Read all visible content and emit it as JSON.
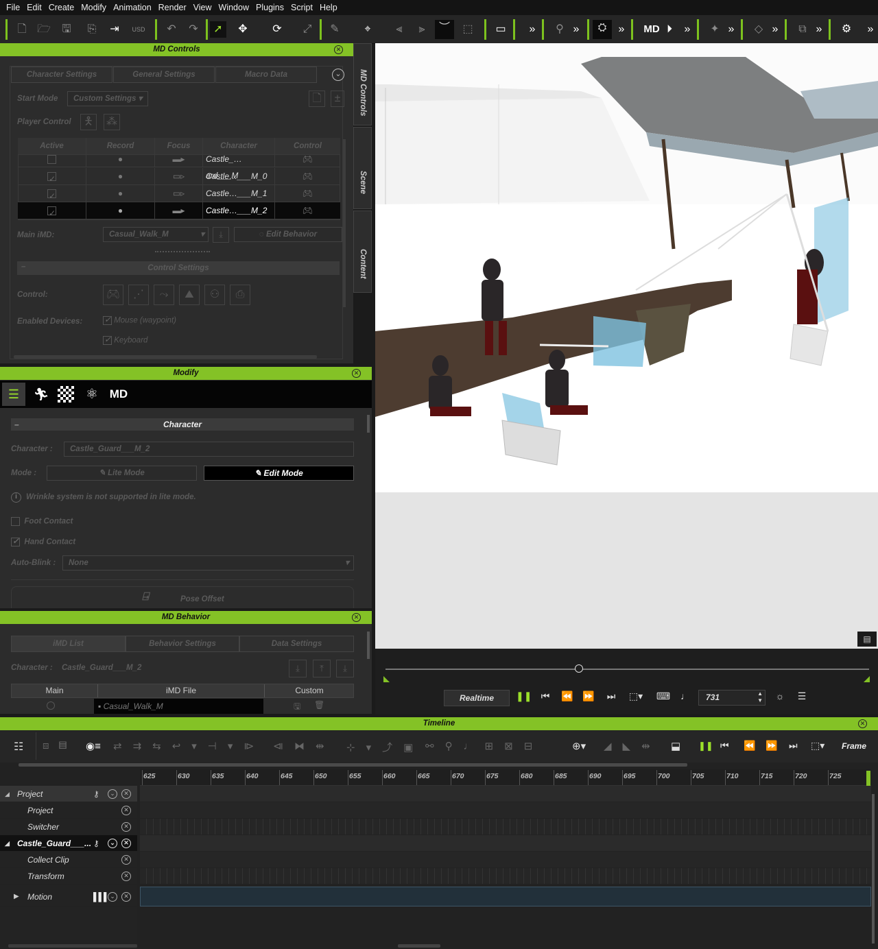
{
  "menu": [
    "File",
    "Edit",
    "Create",
    "Modify",
    "Animation",
    "Render",
    "View",
    "Window",
    "Plugins",
    "Script",
    "Help"
  ],
  "toolbar": {
    "icons": [
      "new-file",
      "open-file",
      "save",
      "export",
      "import",
      "usd",
      "undo",
      "redo",
      "select",
      "move",
      "rotate",
      "scale",
      "paint",
      "ik",
      "align-left",
      "align-right",
      "eye",
      "camera-frame",
      "view-toggle",
      "more",
      "physics",
      "more",
      "camera",
      "more",
      "md-play",
      "more",
      "motion-puppet",
      "more",
      "keyframe",
      "more",
      "sequence",
      "more",
      "gizmo",
      "more"
    ],
    "md_label": "MD"
  },
  "md_controls": {
    "title": "MD Controls",
    "tabs": [
      "Character Settings",
      "General Settings",
      "Macro Data"
    ],
    "start_mode_label": "Start Mode",
    "start_mode_value": "Custom Settings",
    "player_control_label": "Player Control",
    "table_headers": [
      "Active",
      "Record",
      "Focus",
      "Character",
      "Control"
    ],
    "rows": [
      {
        "active": false,
        "character": "Castle_…ard___M",
        "selected": false
      },
      {
        "active": true,
        "character": "Castle…___M_0",
        "selected": false
      },
      {
        "active": true,
        "character": "Castle…___M_1",
        "selected": false
      },
      {
        "active": true,
        "character": "Castle…___M_2",
        "selected": true
      }
    ],
    "main_imd_label": "Main iMD:",
    "main_imd_value": "Casual_Walk_M",
    "edit_behavior": "Edit Behavior",
    "control_settings": "Control Settings",
    "control_label": "Control:",
    "enabled_devices_label": "Enabled Devices:",
    "device_mouse": "Mouse (waypoint)",
    "device_keyboard": "Keyboard"
  },
  "side_tabs": [
    "MD Controls",
    "Scene",
    "Content"
  ],
  "modify": {
    "title": "Modify",
    "section": "Character",
    "character_label": "Character :",
    "character_value": "Castle_Guard___M_2",
    "mode_label": "Mode :",
    "lite_mode": "Lite Mode",
    "edit_mode": "Edit Mode",
    "info": "Wrinkle system is not supported in lite mode.",
    "foot_contact": "Foot Contact",
    "hand_contact": "Hand Contact",
    "auto_blink_label": "Auto-Blink :",
    "auto_blink_value": "None",
    "pose_offset": "Pose Offset",
    "tab_md_label": "MD"
  },
  "md_behavior": {
    "title": "MD Behavior",
    "tabs": [
      "iMD List",
      "Behavior Settings",
      "Data Settings"
    ],
    "character_label": "Character :",
    "character_value": "Castle_Guard___M_2",
    "table_headers": [
      "Main",
      "iMD File",
      "Custom"
    ],
    "row_file": "Casual_Walk_M"
  },
  "playback": {
    "realtime": "Realtime",
    "frame_value": "731",
    "progress": 0.4
  },
  "timeline": {
    "title": "Timeline",
    "frame_label": "Frame",
    "ticks": [
      "625",
      "630",
      "635",
      "640",
      "645",
      "650",
      "655",
      "660",
      "665",
      "670",
      "675",
      "680",
      "685",
      "690",
      "695",
      "700",
      "705",
      "710",
      "715",
      "720",
      "725"
    ],
    "tracks": [
      {
        "label": "Project",
        "level": 0,
        "bold": false
      },
      {
        "label": "Project",
        "level": 1,
        "bold": false
      },
      {
        "label": "Switcher",
        "level": 1,
        "bold": false
      },
      {
        "label": "Castle_Guard___...",
        "level": 0,
        "bold": true
      },
      {
        "label": "Collect Clip",
        "level": 1,
        "bold": false
      },
      {
        "label": "Transform",
        "level": 1,
        "bold": false
      },
      {
        "label": "Motion",
        "level": 1,
        "bold": false
      }
    ]
  },
  "colors": {
    "accent": "#84c226",
    "panel": "#2c2c2c",
    "motion_lane": "#22303a"
  }
}
